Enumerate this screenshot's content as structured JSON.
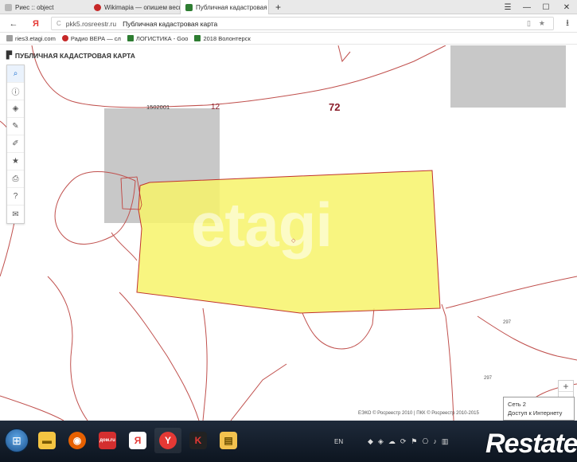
{
  "browser": {
    "tabs": [
      {
        "label": "Риес :: object",
        "favicon_color": "#b8b8b8"
      },
      {
        "label": "Wikimapia — опишем весь",
        "favicon_color": "#c62828"
      },
      {
        "label": "Публичная кадастровая",
        "favicon_color": "#2e7d32"
      }
    ],
    "new_tab_label": "+",
    "menu_icon": "☰",
    "minimize_icon": "—",
    "maximize_icon": "☐",
    "close_icon": "✕",
    "back_icon": "←",
    "yandex_icon": "Я",
    "reload_icon": "C",
    "url_domain": "pkk5.rosreestr.ru",
    "url_title": "Публичная кадастровая карта",
    "bookmark_star_icon": "★",
    "download_icon": "⭳",
    "bookmarks": [
      {
        "label": "ries3.etagi.com",
        "color": "#9e9e9e"
      },
      {
        "label": "Радио ВЕРА — сл",
        "color": "#c62828"
      },
      {
        "label": "ЛОГИСТИКА - Goo",
        "color": "#2e7d32"
      },
      {
        "label": "2018 Волонтерск",
        "color": "#2e7d32"
      }
    ]
  },
  "map": {
    "title": "ПУБЛИЧНАЯ КАДАСТРОВАЯ КАРТА",
    "title_icon": "⯈",
    "tools": [
      {
        "name": "search",
        "glyph": "🔍"
      },
      {
        "name": "info",
        "glyph": "ⓘ"
      },
      {
        "name": "layers",
        "glyph": "◈"
      },
      {
        "name": "draw",
        "glyph": "✎"
      },
      {
        "name": "measure",
        "glyph": "✐"
      },
      {
        "name": "favorites",
        "glyph": "★"
      },
      {
        "name": "print",
        "glyph": "⎙"
      },
      {
        "name": "help",
        "glyph": "?"
      },
      {
        "name": "mail",
        "glyph": "✉"
      }
    ],
    "labels": {
      "quarter_code": "1502001",
      "number_12": "12",
      "number_72": "72",
      "number_297_a": "297",
      "number_297_b": "297",
      "parcel_marker": "◇"
    },
    "watermark": "etagi",
    "zoom_in": "+",
    "zoom_out": "−",
    "copyright": "ЕЭКО © Росреестр 2010 | ПКК © Росреестр 2010-2015",
    "parcel_fill": "#f7f36a",
    "parcel_stroke": "#c0332e",
    "boundary_color": "#c0504d",
    "gray_tile_color": "#c8c8c8"
  },
  "network_tooltip": {
    "line1": "Сеть  2",
    "line2": "Доступ к Интернету"
  },
  "taskbar": {
    "start_icon": "⊞",
    "apps": [
      {
        "name": "folder",
        "glyph": "▬",
        "color": "#f4c542"
      },
      {
        "name": "firefox",
        "glyph": "◉",
        "color": "#e66000"
      },
      {
        "name": "dom-ru",
        "glyph": "дом.ru",
        "color": "#d32f2f"
      },
      {
        "name": "yandex",
        "glyph": "Я",
        "color": "#ffffff"
      },
      {
        "name": "yandex-browser",
        "glyph": "Y",
        "color": "#e53935"
      },
      {
        "name": "kaspersky",
        "glyph": "K",
        "color": "#222222"
      },
      {
        "name": "explorer",
        "glyph": "▤",
        "color": "#f2c14e"
      }
    ],
    "language": "EN",
    "brand": "Restate"
  }
}
